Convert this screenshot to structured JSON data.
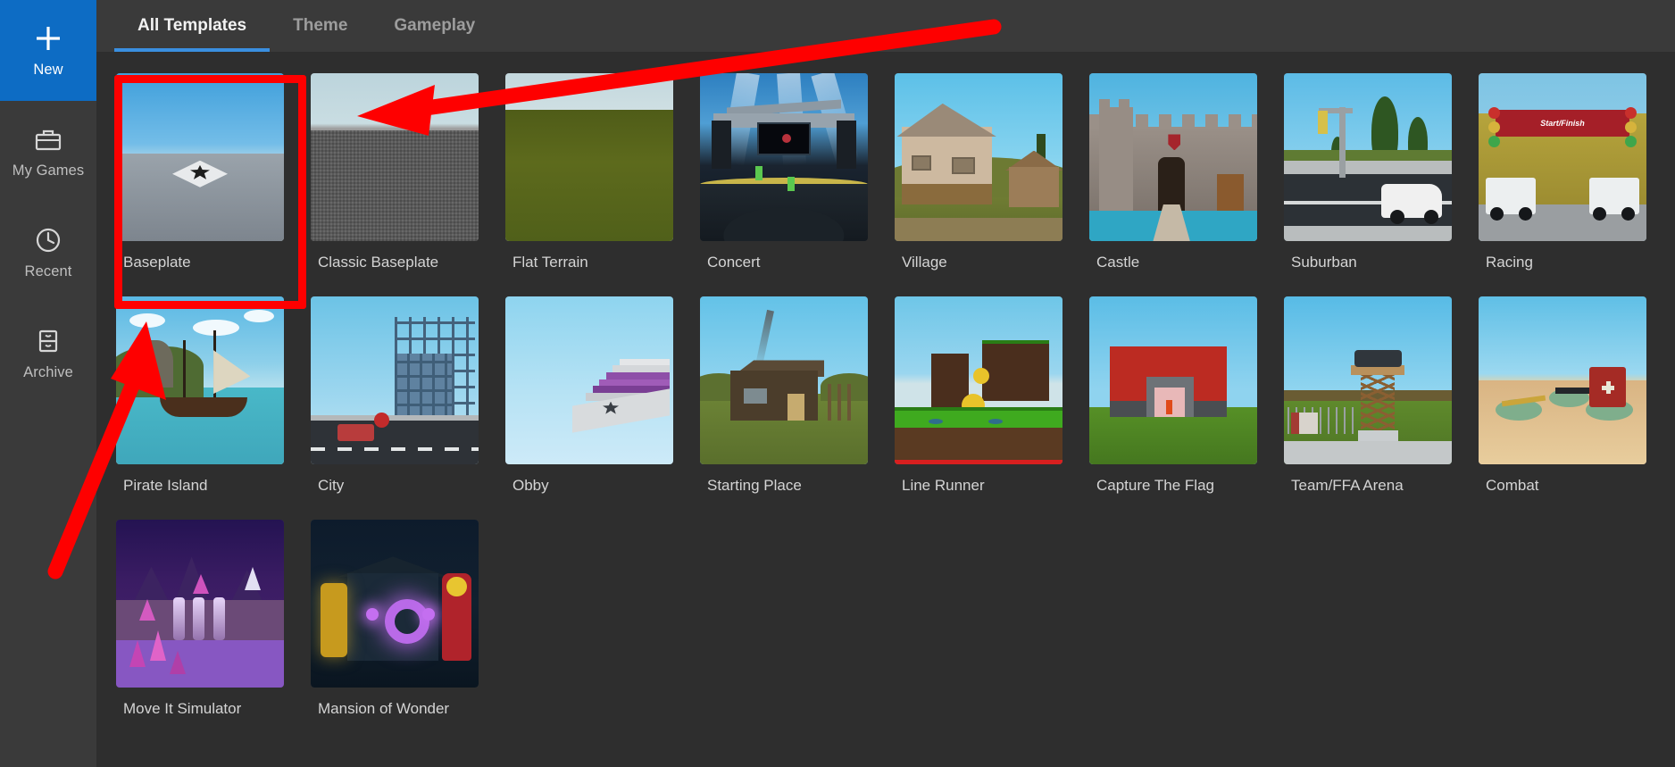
{
  "sidebar": {
    "items": [
      {
        "label": "New",
        "icon": "plus-icon",
        "active": true
      },
      {
        "label": "My Games",
        "icon": "briefcase-icon",
        "active": false
      },
      {
        "label": "Recent",
        "icon": "clock-icon",
        "active": false
      },
      {
        "label": "Archive",
        "icon": "archive-icon",
        "active": false
      }
    ]
  },
  "tabs": [
    {
      "label": "All Templates",
      "active": true
    },
    {
      "label": "Theme",
      "active": false
    },
    {
      "label": "Gameplay",
      "active": false
    }
  ],
  "templates": [
    {
      "label": "Baseplate",
      "theme": "t-baseplate",
      "highlighted": true
    },
    {
      "label": "Classic Baseplate",
      "theme": "t-classic",
      "highlighted": false
    },
    {
      "label": "Flat Terrain",
      "theme": "t-flat",
      "highlighted": false
    },
    {
      "label": "Concert",
      "theme": "t-concert",
      "highlighted": false
    },
    {
      "label": "Village",
      "theme": "t-village",
      "highlighted": false
    },
    {
      "label": "Castle",
      "theme": "t-castle",
      "highlighted": false
    },
    {
      "label": "Suburban",
      "theme": "t-suburban",
      "highlighted": false
    },
    {
      "label": "Racing",
      "theme": "t-racing",
      "highlighted": false
    },
    {
      "label": "Pirate Island",
      "theme": "t-pirate",
      "highlighted": false
    },
    {
      "label": "City",
      "theme": "t-city",
      "highlighted": false
    },
    {
      "label": "Obby",
      "theme": "t-obby",
      "highlighted": false
    },
    {
      "label": "Starting Place",
      "theme": "t-start",
      "highlighted": false
    },
    {
      "label": "Line Runner",
      "theme": "t-line",
      "highlighted": false
    },
    {
      "label": "Capture The Flag",
      "theme": "t-ctf",
      "highlighted": false
    },
    {
      "label": "Team/FFA Arena",
      "theme": "t-arena",
      "highlighted": false
    },
    {
      "label": "Combat",
      "theme": "t-combat",
      "highlighted": false
    },
    {
      "label": "Move It Simulator",
      "theme": "t-move",
      "highlighted": false
    },
    {
      "label": "Mansion of Wonder",
      "theme": "t-mansion",
      "highlighted": false
    }
  ],
  "thumbnail_text": {
    "racing_banner": "Start/Finish"
  },
  "annotations": {
    "highlight_color": "#fe0000",
    "arrow_top_label": "arrow pointing at Classic Baseplate thumbnail",
    "arrow_left_label": "arrow pointing at Baseplate highlight box"
  },
  "colors": {
    "accent_blue": "#0d6cc4",
    "tab_underline": "#3a8fe0",
    "sidebar_bg": "#3a3a3a",
    "main_bg": "#2e2e2e",
    "annotation_red": "#fe0000"
  }
}
